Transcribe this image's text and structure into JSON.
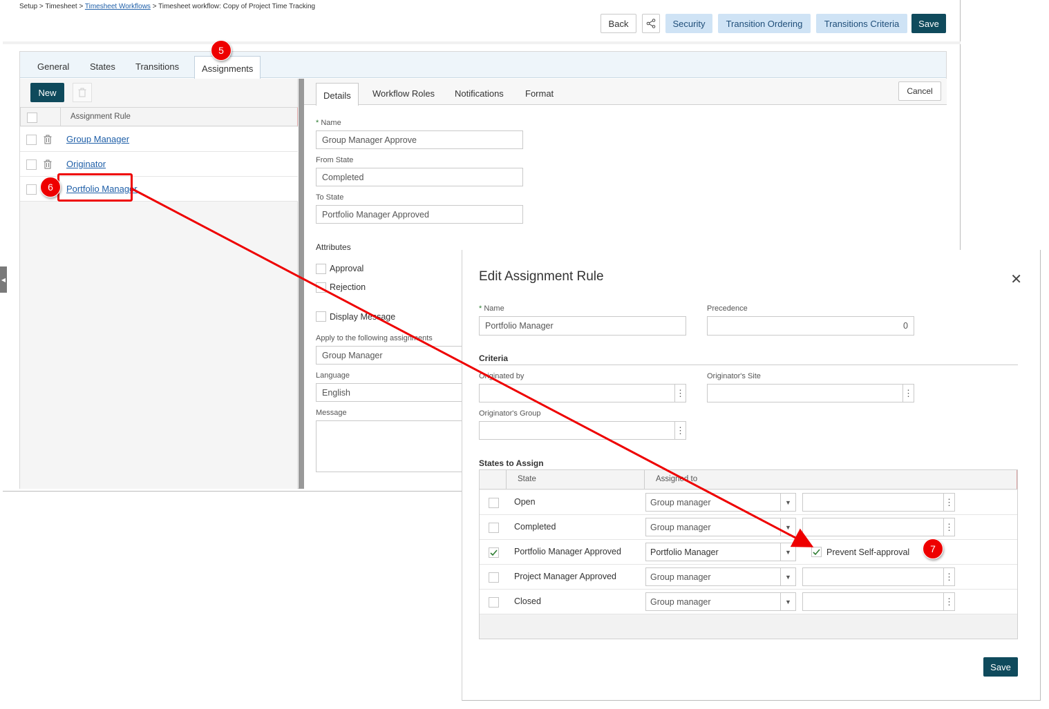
{
  "breadcrumb": {
    "part1": "Setup > Timesheet > ",
    "link": "Timesheet Workflows",
    "part2": " > Timesheet workflow: Copy of Project Time Tracking"
  },
  "toolbar": {
    "back": "Back",
    "security": "Security",
    "transition_ordering": "Transition Ordering",
    "transitions_criteria": "Transitions Criteria",
    "save": "Save"
  },
  "tabs": [
    "General",
    "States",
    "Transitions",
    "Assignments"
  ],
  "left": {
    "new_label": "New",
    "column_header": "Assignment Rule",
    "rows": [
      "Group Manager",
      "Originator",
      "Portfolio Manager"
    ]
  },
  "right": {
    "tabs": [
      "Details",
      "Workflow Roles",
      "Notifications",
      "Format"
    ],
    "cancel": "Cancel",
    "name_label": "Name",
    "name_value": "Group Manager Approve",
    "from_label": "From State",
    "from_value": "Completed",
    "to_label": "To State",
    "to_value": "Portfolio Manager Approved",
    "attributes_label": "Attributes",
    "approval": "Approval",
    "rejection": "Rejection",
    "display_message": "Display Message",
    "apply_label": "Apply to the following assignments",
    "apply_value": "Group Manager",
    "language_label": "Language",
    "language_value": "English",
    "message_label": "Message"
  },
  "modal": {
    "title": "Edit Assignment Rule",
    "name_label": "Name",
    "name_value": "Portfolio Manager",
    "precedence_label": "Precedence",
    "precedence_value": "0",
    "criteria_label": "Criteria",
    "originated_by_label": "Originated by",
    "originators_site_label": "Originator's Site",
    "originators_group_label": "Originator's Group",
    "states_label": "States to Assign",
    "col_state": "State",
    "col_assigned": "Assigned to",
    "rows": [
      {
        "state": "Open",
        "assigned": "Group manager",
        "checked": false
      },
      {
        "state": "Completed",
        "assigned": "Group manager",
        "checked": false
      },
      {
        "state": "Portfolio Manager Approved",
        "assigned": "Portfolio Manager",
        "checked": true,
        "extra": "Prevent Self-approval"
      },
      {
        "state": "Project Manager Approved",
        "assigned": "Group manager",
        "checked": false
      },
      {
        "state": "Closed",
        "assigned": "Group manager",
        "checked": false
      }
    ],
    "save": "Save"
  },
  "callouts": [
    "5",
    "6",
    "7"
  ],
  "colors": {
    "accent_dark": "#0f4a5c",
    "accent_light": "#cfe3f5",
    "annotation": "#e00000"
  }
}
